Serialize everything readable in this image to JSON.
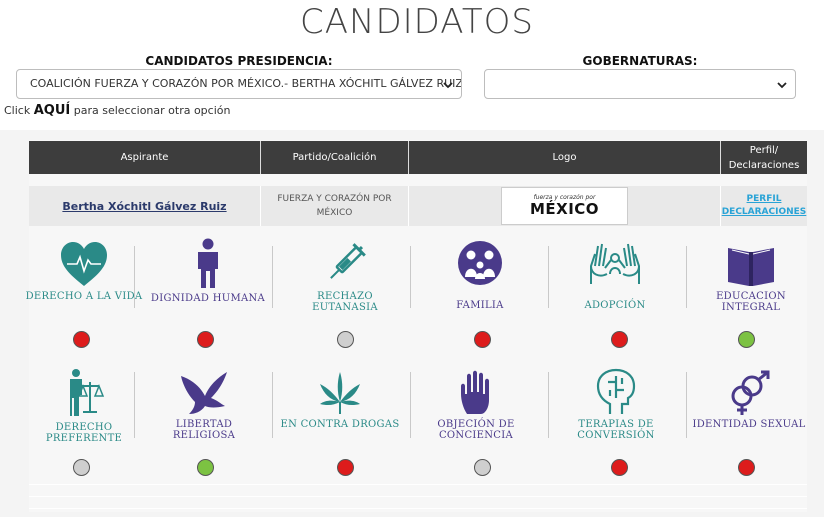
{
  "page_title": "CANDIDATOS",
  "presidencia": {
    "label": "CANDIDATOS PRESIDENCIA:",
    "selected": "COALICIÓN FUERZA Y CORAZÓN POR MÉXICO.- BERTHA XÓCHITL GÁLVEZ RUIZ"
  },
  "gobernaturas": {
    "label": "GOBERNATURAS:",
    "selected": ""
  },
  "click_prefix": "Click",
  "click_aqui": "AQUÍ",
  "click_suffix": "para seleccionar otra opción",
  "table": {
    "headers": [
      "Aspirante",
      "Partido/Coalición",
      "Logo",
      "Perfil/ Declaraciones"
    ],
    "row": {
      "aspirante": "Bertha Xóchitl Gálvez Ruiz",
      "partido": "FUERZA Y CORAZÓN POR MÉXICO",
      "logo_line1": "fuerza y corazón por",
      "logo_line2": "MÉXICO",
      "perfil": "PERFIL",
      "declaraciones": "DECLARACIONES"
    }
  },
  "issues": [
    {
      "label": "Derecho a la Vida",
      "icon": "heart-pulse-icon",
      "status": "red"
    },
    {
      "label": "Dignidad Humana",
      "icon": "person-icon",
      "status": "red"
    },
    {
      "label": "Rechazo Eutanasia",
      "icon": "syringe-icon",
      "status": "gray"
    },
    {
      "label": "Familia",
      "icon": "family-icon",
      "status": "red"
    },
    {
      "label": "Adopción",
      "icon": "hands-icon",
      "status": "red"
    },
    {
      "label": "Educacion Integral",
      "icon": "book-icon",
      "status": "green"
    },
    {
      "label": "Derecho Preferente",
      "icon": "scales-person-icon",
      "status": "gray"
    },
    {
      "label": "Libertad Religiosa",
      "icon": "dove-icon",
      "status": "green"
    },
    {
      "label": "En Contra Drogas",
      "icon": "cannabis-leaf-icon",
      "status": "red"
    },
    {
      "label": "Objeción de Conciencia",
      "icon": "raised-hand-icon",
      "status": "gray"
    },
    {
      "label": "Terapias de Conversión",
      "icon": "head-profile-icon",
      "status": "red"
    },
    {
      "label": "Identidad Sexual",
      "icon": "gender-symbols-icon",
      "status": "red"
    }
  ],
  "colors": {
    "red": "#dd1c1c",
    "green": "#7cc242",
    "gray": "#cfcfcf",
    "teal": "#2a8a87",
    "purple": "#4a3a8a"
  }
}
